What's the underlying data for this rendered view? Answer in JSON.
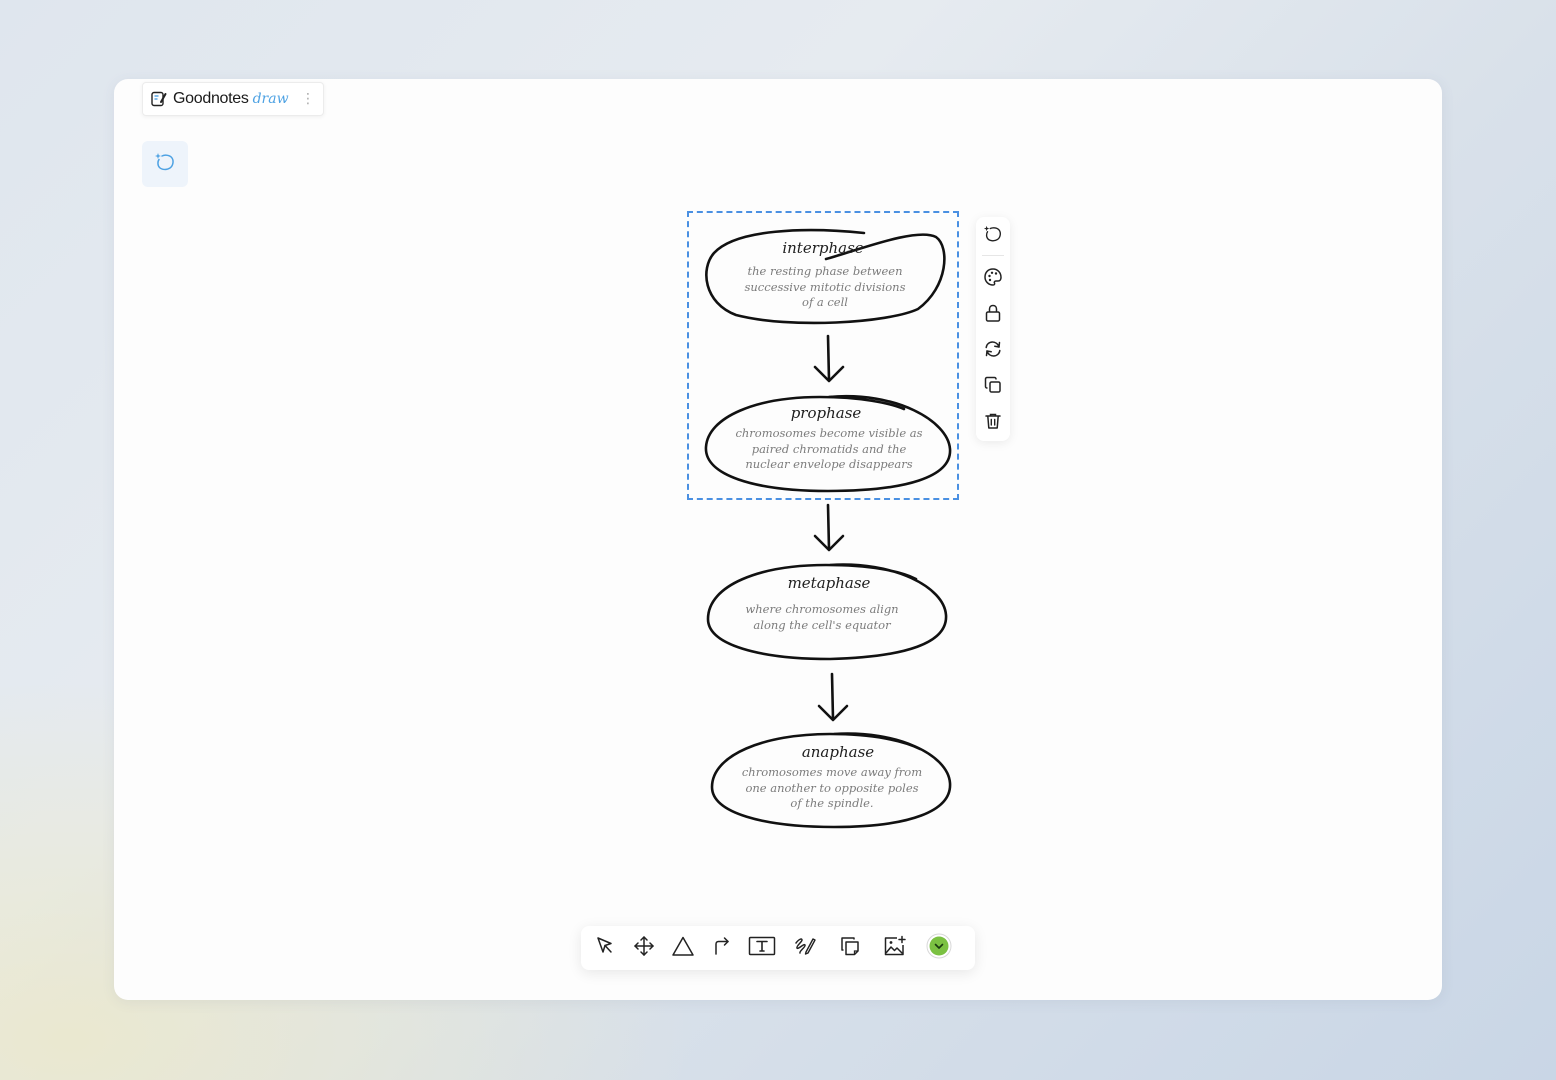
{
  "brand": {
    "name": "Goodnotes",
    "suffix": "draw",
    "menu_icon": "more-vertical-icon"
  },
  "colors": {
    "selection": "#4a90e2",
    "accent_blue": "#4ea2e3",
    "color_picker": "#7bc142",
    "ink": "#111111",
    "description_text": "#7b7b7b"
  },
  "flowchart": {
    "nodes": [
      {
        "title": "interphase",
        "description_lines": [
          "the resting phase between",
          "successive mitotic divisions",
          "of a cell"
        ]
      },
      {
        "title": "prophase",
        "description_lines": [
          "chromosomes become visible as",
          "paired chromatids and the",
          "nuclear envelope disappears"
        ]
      },
      {
        "title": "metaphase",
        "description_lines": [
          "where chromosomes align",
          "along the cell's equator"
        ]
      },
      {
        "title": "anaphase",
        "description_lines": [
          "chromosomes move away from",
          "one another to opposite poles",
          "of the spindle."
        ]
      }
    ]
  },
  "side_toolbar": {
    "tools": [
      {
        "name": "ai-shape",
        "icon": "ai-sparkle-shape-icon"
      },
      {
        "name": "style",
        "icon": "palette-icon"
      },
      {
        "name": "lock",
        "icon": "lock-icon"
      },
      {
        "name": "regenerate",
        "icon": "refresh-icon"
      },
      {
        "name": "duplicate",
        "icon": "copy-icon"
      },
      {
        "name": "delete",
        "icon": "trash-icon"
      }
    ]
  },
  "bottom_toolbar": {
    "tools": [
      {
        "name": "select",
        "icon": "cursor-arrow-icon"
      },
      {
        "name": "move",
        "icon": "move-arrows-icon"
      },
      {
        "name": "shape",
        "icon": "triangle-icon"
      },
      {
        "name": "connector",
        "icon": "corner-arrow-icon"
      },
      {
        "name": "text",
        "icon": "text-box-icon"
      },
      {
        "name": "pen",
        "icon": "pen-scribble-icon"
      },
      {
        "name": "sticky-note",
        "icon": "sticky-note-icon"
      },
      {
        "name": "image",
        "icon": "add-image-icon"
      },
      {
        "name": "color-picker",
        "icon": "chevron-down-icon"
      }
    ]
  },
  "left_panel": {
    "ai_button_icon": "ai-sparkle-shape-icon"
  }
}
